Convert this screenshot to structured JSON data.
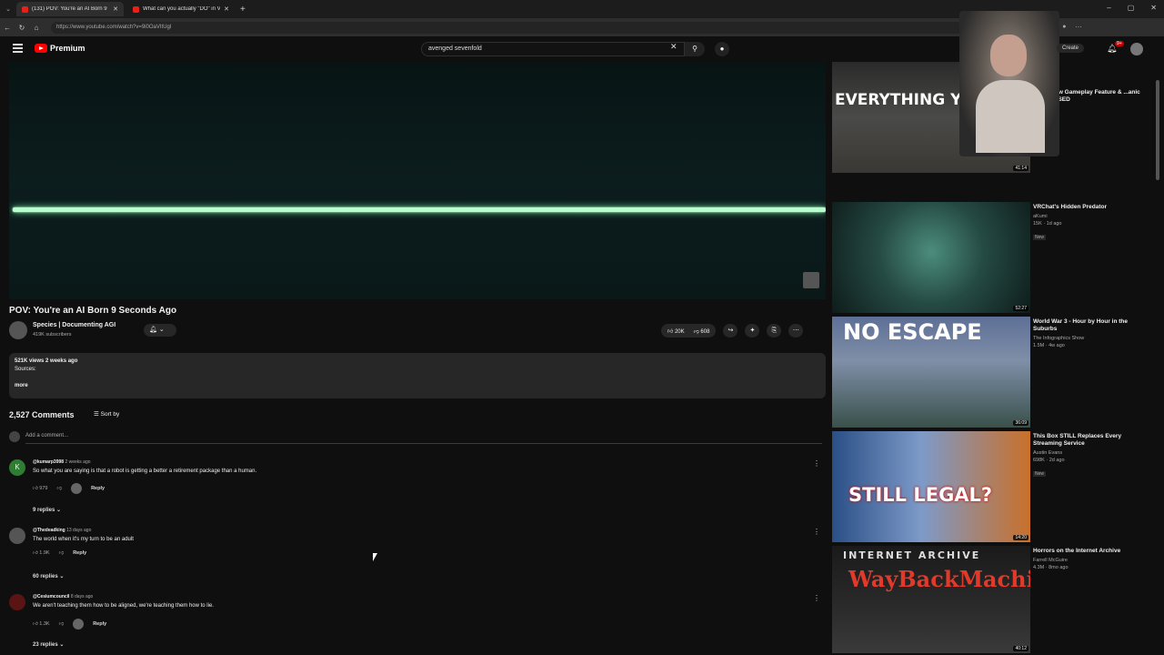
{
  "browser": {
    "tabs": [
      {
        "title": "(131) POV: You're an AI Born 9",
        "active": true
      },
      {
        "title": "What can you actually \"DO\" in VRC",
        "active": false
      }
    ],
    "url": "https://www.youtube.com/watch?v=9i0OaVItUgI"
  },
  "masthead": {
    "logo": "Premium",
    "search_value": "avenged sevenfold",
    "create": "Create",
    "notif_count": "9+"
  },
  "video": {
    "title": "POV: You're an AI Born 9 Seconds Ago",
    "channel": "Species | Documenting AGI",
    "subscribers": "419K subscribers",
    "likes": "20K",
    "dislikes": "608",
    "views_date": "521K views  2 weeks ago",
    "sources": "Sources:",
    "more": "more"
  },
  "comments_header": {
    "count": "2,527 Comments",
    "sort": "Sort by",
    "add_placeholder": "Add a comment..."
  },
  "comments": [
    {
      "user": "@kumarp3998",
      "time": "2 weeks ago",
      "text": "So what you are saying is that a robot is getting a better a retirement package than a human.",
      "likes": "979",
      "reply": "Reply",
      "replies": "9 replies",
      "avatar_letter": "K",
      "avatar_color": "#2e7d32"
    },
    {
      "user": "@Thedeadking",
      "time": "13 days ago",
      "text": "The world when it's my turn to be an adult",
      "likes": "1.9K",
      "reply": "Reply",
      "replies": "60 replies",
      "avatar_letter": "",
      "avatar_color": "#555555"
    },
    {
      "user": "@Cesiumcouncil",
      "time": "8 days ago",
      "text": "We aren't teaching them how to be aligned, we're teaching them how to lie.",
      "likes": "1.3K",
      "reply": "Reply",
      "replies": "23 replies",
      "avatar_letter": "",
      "avatar_color": "#5a1414"
    }
  ],
  "recommendations": [
    {
      "title": "Every New Gameplay Feature & ...anic YOU MISSED",
      "channel": "",
      "meta": "2d ago",
      "duration": "41:14",
      "thumb_text": "EVERYTHING YO",
      "new": ""
    },
    {
      "title": "VRChat's Hidden Predator",
      "channel": "aKumi",
      "meta": "15K · 1d ago",
      "duration": "52:27",
      "thumb_text": "",
      "new": "New"
    },
    {
      "title": "World War 3 - Hour by Hour in the Suburbs",
      "channel": "The Infographics Show",
      "meta": "1.5M · 4w ago",
      "duration": "36:09",
      "thumb_text": "NO ESCAPE",
      "new": ""
    },
    {
      "title": "This Box STILL Replaces Every Streaming Service",
      "channel": "Austin Evans",
      "meta": "698K · 2d ago",
      "duration": "14:20",
      "thumb_text": "STILL LEGAL?",
      "new": "New"
    },
    {
      "title": "Horrors on the Internet Archive",
      "channel": "Farrell McGuire",
      "meta": "4.3M · 8mo ago",
      "duration": "40:12",
      "thumb_text": "INTERNET ARCHIVE",
      "thumb_text2": "WayBackMachine",
      "new": ""
    }
  ]
}
